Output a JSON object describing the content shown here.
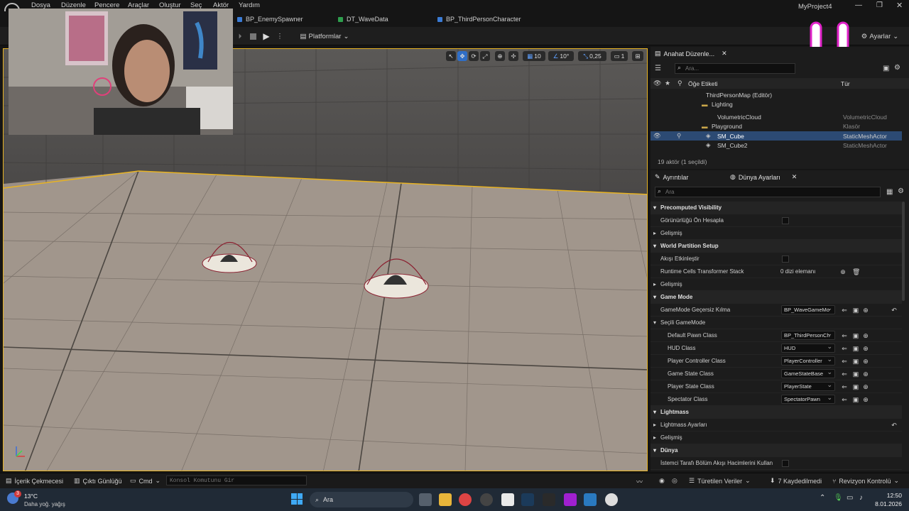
{
  "menu": [
    "Dosya",
    "Düzenle",
    "Pencere",
    "Araçlar",
    "Oluştur",
    "Seç",
    "Aktör",
    "Yardım"
  ],
  "project_title": "MyProject4",
  "doc_tabs": [
    {
      "label": "BP_EnemySpawner",
      "color": "#3a7bd5"
    },
    {
      "label": "DT_WaveData",
      "color": "#2e9e4d"
    },
    {
      "label": "BP_ThirdPersonCharacter",
      "color": "#3a7bd5"
    }
  ],
  "toolbar": {
    "platforms": "Platformlar",
    "settings": "Ayarlar"
  },
  "viewport": {
    "grid": "10",
    "angle": "10°",
    "scale": "0,25",
    "camera": "1"
  },
  "outliner": {
    "tab": "Anahat Düzenle...",
    "search_placeholder": "Ara...",
    "col_label": "Öğe Etiketi",
    "col_type": "Tür",
    "rows": [
      {
        "name": "ThirdPersonMap (Editör)",
        "type": ""
      },
      {
        "name": "Lighting",
        "type": ""
      },
      {
        "name": "VolumetricCloud",
        "type": "VolumetricCloud"
      },
      {
        "name": "Playground",
        "type": "Klasör"
      },
      {
        "name": "SM_Cube",
        "type": "StaticMeshActor"
      },
      {
        "name": "SM_Cube2",
        "type": "StaticMeshActor"
      }
    ],
    "count": "19 aktör (1 seçildi)"
  },
  "details": {
    "tab1": "Ayrıntılar",
    "tab2": "Dünya Ayarları",
    "search_placeholder": "Ara",
    "rows": [
      {
        "label": "Precomputed Visibility",
        "kind": "cat"
      },
      {
        "label": "Görünürlüğü Ön Hesapla",
        "kind": "chk"
      },
      {
        "label": "Gelişmiş",
        "kind": "sub"
      },
      {
        "label": "World Partition Setup",
        "kind": "cat"
      },
      {
        "label": "Akışı Etkinleştir",
        "kind": "chk"
      },
      {
        "label": "Runtime Cells Transformer Stack",
        "kind": "text",
        "value": "0 dizi elemanı"
      },
      {
        "label": "Gelişmiş",
        "kind": "sub"
      },
      {
        "label": "Game Mode",
        "kind": "cat"
      },
      {
        "label": "GameMode Geçersiz Kılma",
        "kind": "combo",
        "value": "BP_WaveGameMo"
      },
      {
        "label": "Seçili GameMode",
        "kind": "sub"
      },
      {
        "label": "Default Pawn Class",
        "kind": "combo2",
        "value": "BP_ThirdPersonCh"
      },
      {
        "label": "HUD Class",
        "kind": "combo2",
        "value": "HUD"
      },
      {
        "label": "Player Controller Class",
        "kind": "combo2",
        "value": "PlayerController"
      },
      {
        "label": "Game State Class",
        "kind": "combo2",
        "value": "GameStateBase"
      },
      {
        "label": "Player State Class",
        "kind": "combo2",
        "value": "PlayerState"
      },
      {
        "label": "Spectator Class",
        "kind": "combo2",
        "value": "SpectatorPawn"
      },
      {
        "label": "Lightmass",
        "kind": "cat"
      },
      {
        "label": "Lightmass Ayarları",
        "kind": "sub"
      },
      {
        "label": "Gelişmiş",
        "kind": "sub"
      },
      {
        "label": "Dünya",
        "kind": "cat"
      },
      {
        "label": "İstemci Tarafı Bölüm Akışı Hacimlerini Kullan",
        "kind": "chk"
      }
    ]
  },
  "statusbar": {
    "content_drawer": "İçerik Çekmecesi",
    "output_log": "Çıktı Günlüğü",
    "cmd": "Cmd",
    "console_placeholder": "Konsol Komutunu Gir",
    "derived": "Türetilen Veriler",
    "unsaved": "7 Kaydedilmedi",
    "revision": "Revizyon Kontrolü"
  },
  "taskbar": {
    "temp": "13°C",
    "weather": "Daha yoğ. yağış",
    "search": "Ara",
    "time": "12:50",
    "date": "8.01.2026",
    "badge": "3"
  }
}
